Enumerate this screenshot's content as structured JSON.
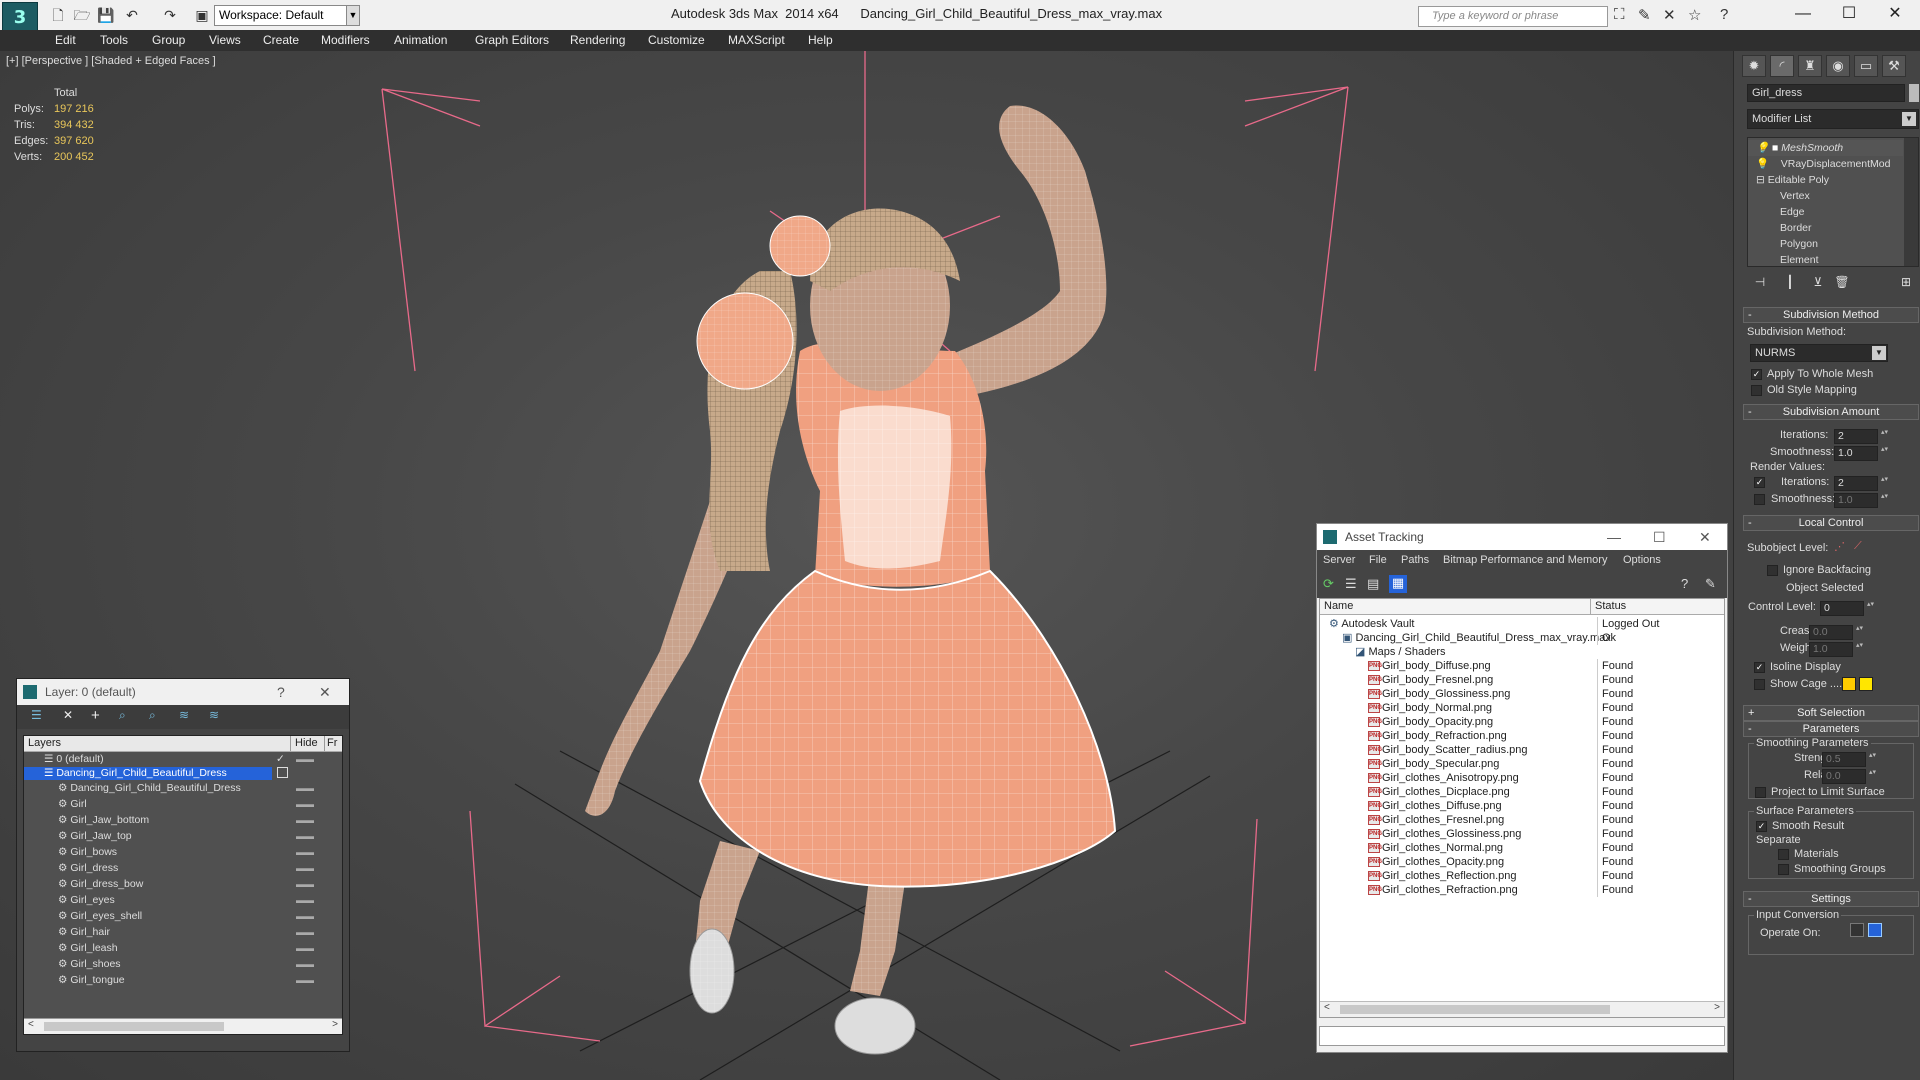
{
  "app": {
    "title": "Autodesk 3ds Max  2014 x64      Dancing_Girl_Child_Beautiful_Dress_max_vray.max",
    "workspace": "Workspace: Default",
    "search_placeholder": "Type a keyword or phrase"
  },
  "menu": [
    "Edit",
    "Tools",
    "Group",
    "Views",
    "Create",
    "Modifiers",
    "Animation",
    "Graph Editors",
    "Rendering",
    "Customize",
    "MAXScript",
    "Help"
  ],
  "viewport": {
    "label": "[+] [Perspective ] [Shaded + Edged Faces ]",
    "stats": {
      "total_label": "Total",
      "rows": [
        {
          "label": "Polys:",
          "value": "197 216"
        },
        {
          "label": "Tris:",
          "value": "394 432"
        },
        {
          "label": "Edges:",
          "value": "397 620"
        },
        {
          "label": "Verts:",
          "value": "200 452"
        }
      ]
    }
  },
  "command_panel": {
    "object_name": "Girl_dress",
    "modifier_list": "Modifier List",
    "stack": [
      {
        "label": "MeshSmooth",
        "indent": 0,
        "selected": true
      },
      {
        "label": "VRayDisplacementMod",
        "indent": 0,
        "selected": false
      },
      {
        "label": "Editable Poly",
        "indent": 0,
        "selected": false
      },
      {
        "label": "Vertex",
        "indent": 1,
        "selected": false
      },
      {
        "label": "Edge",
        "indent": 1,
        "selected": false
      },
      {
        "label": "Border",
        "indent": 1,
        "selected": false
      },
      {
        "label": "Polygon",
        "indent": 1,
        "selected": false
      },
      {
        "label": "Element",
        "indent": 1,
        "selected": false
      }
    ],
    "subdivision_method": {
      "title": "Subdivision Method",
      "label": "Subdivision Method:",
      "value": "NURMS",
      "apply_whole_mesh": "Apply To Whole Mesh",
      "old_style": "Old Style Mapping"
    },
    "subdivision_amount": {
      "title": "Subdivision Amount",
      "iterations_label": "Iterations:",
      "iterations": "2",
      "smoothness_label": "Smoothness:",
      "smoothness": "1.0",
      "render_values": "Render Values:",
      "render_iterations": "2",
      "render_smoothness": "1.0"
    },
    "local_control": {
      "title": "Local Control",
      "subobject_level": "Subobject Level:",
      "ignore_backfacing": "Ignore Backfacing",
      "object_selected": "Object Selected",
      "control_level_label": "Control Level:",
      "control_level": "0",
      "crease_label": "Crease:",
      "crease": "0.0",
      "weight_label": "Weight:",
      "weight": "1.0",
      "isoline": "Isoline Display",
      "show_cage": "Show Cage ......"
    },
    "soft_selection": "Soft Selection",
    "parameters": {
      "title": "Parameters",
      "smoothing_params": "Smoothing Parameters",
      "strength_label": "Strength:",
      "strength": "0.5",
      "relax_label": "Relax:",
      "relax": "0.0",
      "project": "Project to Limit Surface",
      "surface_params": "Surface Parameters",
      "smooth_result": "Smooth Result",
      "separate": "Separate",
      "materials": "Materials",
      "smoothing_groups": "Smoothing Groups"
    },
    "settings": "Settings",
    "input_conversion": "Input Conversion",
    "operate_on": "Operate On:"
  },
  "layer_window": {
    "title": "Layer: 0 (default)",
    "help": "?",
    "cols": {
      "layers": "Layers",
      "hide": "Hide",
      "fr": "Fr"
    },
    "rows": [
      {
        "label": "0 (default)",
        "indent": 1,
        "type": "layer",
        "check": true
      },
      {
        "label": "Dancing_Girl_Child_Beautiful_Dress",
        "indent": 1,
        "type": "layer",
        "selected": true
      },
      {
        "label": "Dancing_Girl_Child_Beautiful_Dress",
        "indent": 2,
        "type": "obj"
      },
      {
        "label": "Girl",
        "indent": 2,
        "type": "obj"
      },
      {
        "label": "Girl_Jaw_bottom",
        "indent": 2,
        "type": "obj"
      },
      {
        "label": "Girl_Jaw_top",
        "indent": 2,
        "type": "obj"
      },
      {
        "label": "Girl_bows",
        "indent": 2,
        "type": "obj"
      },
      {
        "label": "Girl_dress",
        "indent": 2,
        "type": "obj"
      },
      {
        "label": "Girl_dress_bow",
        "indent": 2,
        "type": "obj"
      },
      {
        "label": "Girl_eyes",
        "indent": 2,
        "type": "obj"
      },
      {
        "label": "Girl_eyes_shell",
        "indent": 2,
        "type": "obj"
      },
      {
        "label": "Girl_hair",
        "indent": 2,
        "type": "obj"
      },
      {
        "label": "Girl_leash",
        "indent": 2,
        "type": "obj"
      },
      {
        "label": "Girl_shoes",
        "indent": 2,
        "type": "obj"
      },
      {
        "label": "Girl_tongue",
        "indent": 2,
        "type": "obj"
      }
    ]
  },
  "asset_tracking": {
    "title": "Asset Tracking",
    "menu": [
      "Server",
      "File",
      "Paths",
      "Bitmap Performance and Memory",
      "Options"
    ],
    "cols": {
      "name": "Name",
      "status": "Status"
    },
    "rows": [
      {
        "name": "Autodesk Vault",
        "status": "Logged Out",
        "indent": 1,
        "icon": "vault"
      },
      {
        "name": "Dancing_Girl_Child_Beautiful_Dress_max_vray.max",
        "status": "Ok",
        "indent": 2,
        "icon": "max"
      },
      {
        "name": "Maps / Shaders",
        "status": "",
        "indent": 3,
        "icon": "maps"
      },
      {
        "name": "Girl_body_Diffuse.png",
        "status": "Found",
        "indent": 4,
        "icon": "png"
      },
      {
        "name": "Girl_body_Fresnel.png",
        "status": "Found",
        "indent": 4,
        "icon": "png"
      },
      {
        "name": "Girl_body_Glossiness.png",
        "status": "Found",
        "indent": 4,
        "icon": "png"
      },
      {
        "name": "Girl_body_Normal.png",
        "status": "Found",
        "indent": 4,
        "icon": "png"
      },
      {
        "name": "Girl_body_Opacity.png",
        "status": "Found",
        "indent": 4,
        "icon": "png"
      },
      {
        "name": "Girl_body_Refraction.png",
        "status": "Found",
        "indent": 4,
        "icon": "png"
      },
      {
        "name": "Girl_body_Scatter_radius.png",
        "status": "Found",
        "indent": 4,
        "icon": "png"
      },
      {
        "name": "Girl_body_Specular.png",
        "status": "Found",
        "indent": 4,
        "icon": "png"
      },
      {
        "name": "Girl_clothes_Anisotropy.png",
        "status": "Found",
        "indent": 4,
        "icon": "png"
      },
      {
        "name": "Girl_clothes_Dicplace.png",
        "status": "Found",
        "indent": 4,
        "icon": "png"
      },
      {
        "name": "Girl_clothes_Diffuse.png",
        "status": "Found",
        "indent": 4,
        "icon": "png"
      },
      {
        "name": "Girl_clothes_Fresnel.png",
        "status": "Found",
        "indent": 4,
        "icon": "png"
      },
      {
        "name": "Girl_clothes_Glossiness.png",
        "status": "Found",
        "indent": 4,
        "icon": "png"
      },
      {
        "name": "Girl_clothes_Normal.png",
        "status": "Found",
        "indent": 4,
        "icon": "png"
      },
      {
        "name": "Girl_clothes_Opacity.png",
        "status": "Found",
        "indent": 4,
        "icon": "png"
      },
      {
        "name": "Girl_clothes_Reflection.png",
        "status": "Found",
        "indent": 4,
        "icon": "png"
      },
      {
        "name": "Girl_clothes_Refraction.png",
        "status": "Found",
        "indent": 4,
        "icon": "png"
      }
    ]
  },
  "colors": {
    "dress": "#f0a080",
    "skin": "#c9a38d",
    "wire": "#ffffff",
    "bbox": "#e86a8a",
    "selection": "#2563d9",
    "cage_a": "#ffcc00",
    "cage_b": "#ffe600"
  }
}
